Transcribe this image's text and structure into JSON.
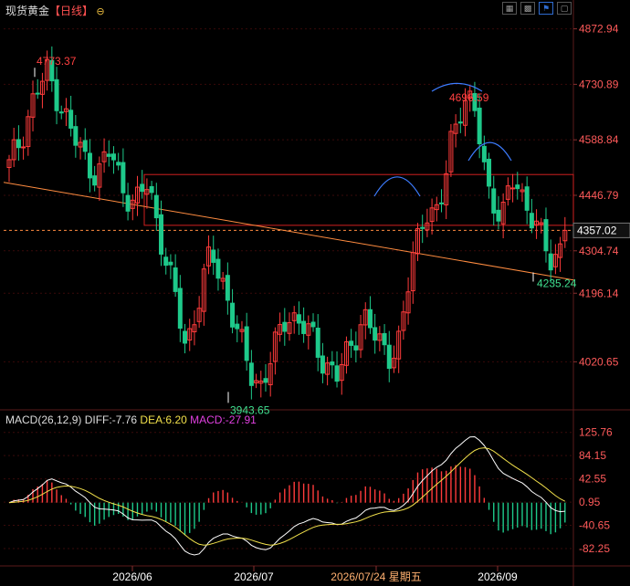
{
  "header": {
    "instrument": "现货黄金",
    "period": "【日线】",
    "expand_icon": "circle-minus-icon",
    "toolbar_icons": [
      "layout-icon",
      "grid-icon",
      "flag-icon",
      "window-icon"
    ]
  },
  "macd": {
    "label": "MACD(26,12,9)",
    "diff": "DIFF:-7.76",
    "dea": "DEA:6.20",
    "macd": "MACD:-27.91"
  },
  "colors": {
    "up": "#ff3b3b",
    "down": "#1ec98a",
    "bg": "#000000",
    "grid": "#3a0a0a",
    "trend": "#ff8c40",
    "dashed": "#ff8c40",
    "diff": "#ffffff",
    "dea": "#f2e14b",
    "macd_label": "#e040e0",
    "arc": "#3d7cff"
  },
  "chart_data": [
    {
      "type": "candlestick",
      "title": "现货黄金【日线】",
      "ylim": [
        3900,
        4900
      ],
      "y_ticks": [
        4872.94,
        4730.89,
        4588.84,
        4446.79,
        4304.74,
        4196.14,
        4020.65
      ],
      "price_tag": "4357.02",
      "current_price": 4357.02,
      "x_tick_labels": [
        "2026/06",
        "2026/07",
        "2026/07/24 星期五",
        "2026/09"
      ],
      "annotations": [
        {
          "text": "4773.37",
          "value": 4773.37
        },
        {
          "text": "4696.59",
          "value": 4696.59
        },
        {
          "text": "4235.24",
          "value": 4235.24
        },
        {
          "text": "3943.65",
          "value": 3943.65
        }
      ],
      "key_closes": [
        4520,
        4600,
        4700,
        4760,
        4690,
        4600,
        4540,
        4500,
        4560,
        4470,
        4420,
        4480,
        4340,
        4200,
        4060,
        4180,
        4300,
        4220,
        4100,
        4000,
        3960,
        4050,
        4150,
        4120,
        4080,
        4020,
        3980,
        4060,
        4140,
        4080,
        4040,
        4080,
        4300,
        4420,
        4380,
        4600,
        4700,
        4640,
        4460,
        4380,
        4500,
        4420,
        4340,
        4280,
        4340
      ]
    },
    {
      "type": "bar",
      "title": "MACD(26,12,9)",
      "ylim": [
        -110,
        140
      ],
      "y_ticks": [
        125.76,
        84.15,
        42.55,
        0.95,
        -40.65,
        -82.25
      ],
      "series": [
        {
          "name": "DIFF",
          "value": -7.76
        },
        {
          "name": "DEA",
          "value": 6.2
        },
        {
          "name": "MACD",
          "value": -27.91
        }
      ]
    }
  ]
}
